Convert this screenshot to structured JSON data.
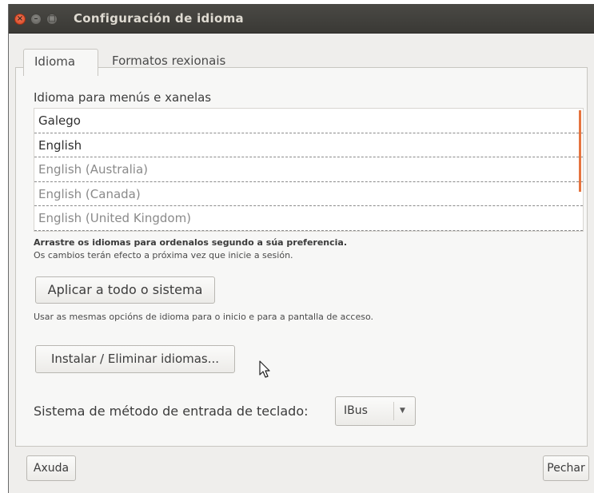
{
  "window": {
    "title": "Configuración de idioma",
    "controls": [
      "close-icon",
      "minimize-icon",
      "maximize-icon"
    ]
  },
  "tabs": [
    {
      "label": "Idioma",
      "active": true
    },
    {
      "label": "Formatos rexionais",
      "active": false
    }
  ],
  "language_section": {
    "label": "Idioma para menús e xanelas",
    "languages": [
      {
        "name": "Galego",
        "style": "primary"
      },
      {
        "name": "English",
        "style": "primary"
      },
      {
        "name": "English (Australia)",
        "style": "secondary"
      },
      {
        "name": "English (Canada)",
        "style": "secondary"
      },
      {
        "name": "English (United Kingdom)",
        "style": "secondary"
      }
    ],
    "hint_bold": "Arrastre os idiomas para ordenalos segundo a súa preferencia.",
    "hint": "Os cambios terán efecto a próxima vez que inicie a sesión."
  },
  "apply": {
    "button_label": "Aplicar a todo o sistema",
    "hint": "Usar as mesmas opcións de idioma para o inicio e para a pantalla de acceso."
  },
  "install": {
    "button_label": "Instalar / Eliminar idiomas..."
  },
  "input_method": {
    "label": "Sistema de método de entrada de teclado:",
    "selected": "IBus"
  },
  "footer": {
    "help_label": "Axuda",
    "close_label": "Pechar"
  },
  "colors": {
    "titlebar": "#3c3b37",
    "accent": "#e5743f",
    "close_button": "#e05a35"
  }
}
